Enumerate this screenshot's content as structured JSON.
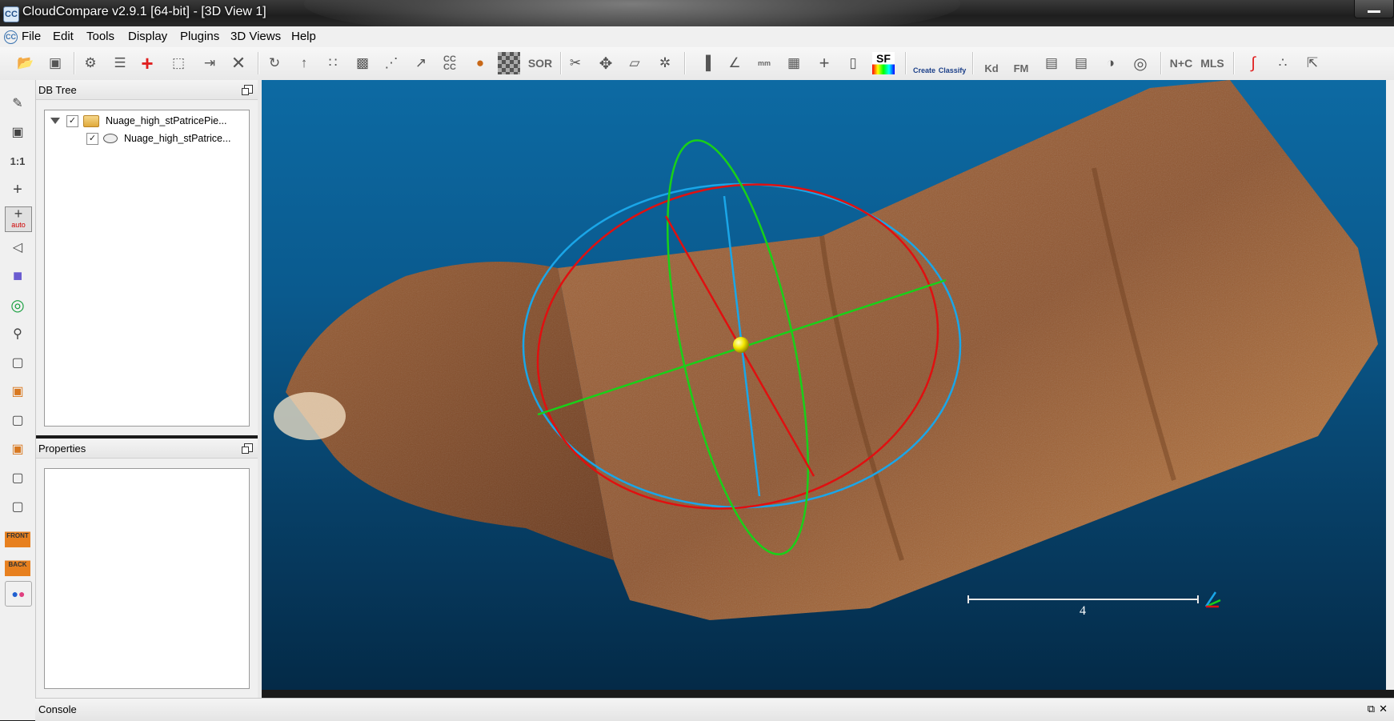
{
  "window": {
    "title": "CloudCompare v2.9.1 [64-bit] - [3D View 1]",
    "app_icon_text": "CC"
  },
  "menu": {
    "items": [
      "File",
      "Edit",
      "Tools",
      "Display",
      "Plugins",
      "3D Views",
      "Help"
    ]
  },
  "toolbar": {
    "cc_label": "CC CC",
    "sor_label": "SOR",
    "sf_label": "SF",
    "canupo_create_label": "Create",
    "canupo_classify_label": "Classify",
    "kd_label": "Kd",
    "fm_label": "FM",
    "nc_label": "N+C",
    "mls_label": "MLS"
  },
  "left_tools": {
    "one_to_one_label": "1:1",
    "auto_label": "auto",
    "front_label": "FRONT",
    "back_label": "BACK"
  },
  "db_tree": {
    "title": "DB Tree",
    "items": [
      {
        "label": "Nuage_high_stPatricePie...",
        "checked": true,
        "type": "folder"
      },
      {
        "label": "Nuage_high_stPatrice...",
        "checked": true,
        "type": "cloud"
      }
    ]
  },
  "properties": {
    "title": "Properties"
  },
  "view3d": {
    "scale_label": "4",
    "sphere_color": "#f2e600",
    "ring_colors": {
      "red": "#e01010",
      "green": "#19d019",
      "blue": "#1aa6e8"
    }
  },
  "console": {
    "title": "Console"
  }
}
